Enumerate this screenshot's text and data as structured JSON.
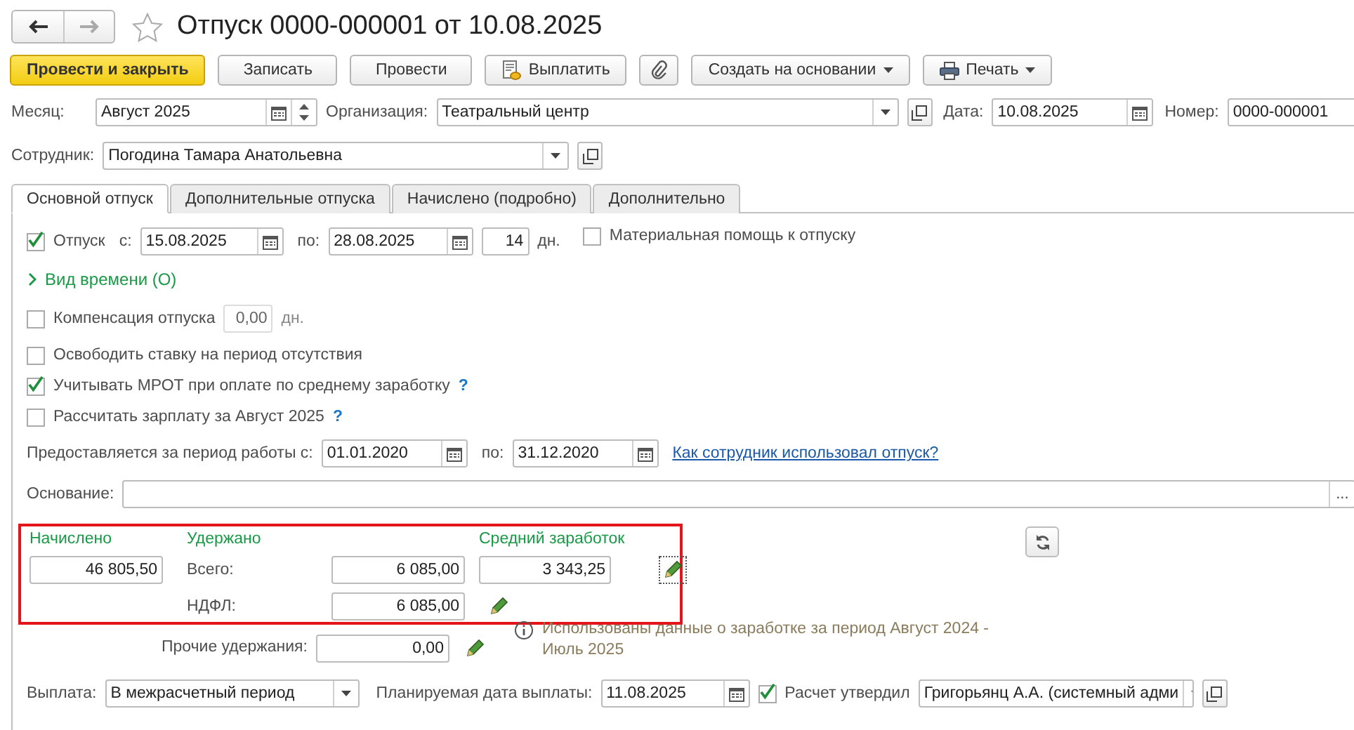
{
  "title": "Отпуск 0000-000001 от 10.08.2025",
  "toolbar": [
    {
      "label": "Провести и закрыть",
      "kind": "primary"
    },
    {
      "label": "Записать",
      "kind": "plain"
    },
    {
      "label": "Провести",
      "kind": "plain"
    },
    {
      "label": "Выплатить",
      "kind": "pay"
    },
    {
      "kind": "attach"
    },
    {
      "label": "Создать на основании",
      "kind": "menu"
    },
    {
      "label": "Печать",
      "kind": "print"
    }
  ],
  "month": {
    "label": "Месяц:",
    "value": "Август 2025"
  },
  "organization": {
    "label": "Организация:",
    "value": "Театральный центр"
  },
  "date": {
    "label": "Дата:",
    "value": "10.08.2025"
  },
  "number": {
    "label": "Номер:",
    "value": "0000-000001"
  },
  "employee": {
    "label": "Сотрудник:",
    "value": "Погодина Тамара Анатольевна"
  },
  "tabs": [
    {
      "label": "Основной отпуск",
      "selected": true
    },
    {
      "label": "Дополнительные отпуска",
      "selected": false
    },
    {
      "label": "Начислено (подробно)",
      "selected": false
    },
    {
      "label": "Дополнительно",
      "selected": false
    }
  ],
  "vacation": {
    "checked": true,
    "label": "Отпуск",
    "from_label": "с:",
    "from": "15.08.2025",
    "to_label": "по:",
    "to": "28.08.2025",
    "days": "14",
    "unit": "дн."
  },
  "material_aid": {
    "checked": false,
    "label": "Материальная помощь к отпуску"
  },
  "time_kind": {
    "label": "Вид времени (О)",
    "expanded": false
  },
  "compensation": {
    "checked": false,
    "label": "Компенсация отпуска",
    "value": "0,00",
    "unit": "дн."
  },
  "options": [
    {
      "checked": false,
      "label": "Освободить ставку на период отсутствия"
    },
    {
      "checked": true,
      "label": "Учитывать МРОТ при оплате по среднему заработку",
      "help": "?"
    },
    {
      "checked": false,
      "label": "Рассчитать зарплату за Август 2025",
      "help": "?"
    }
  ],
  "period": {
    "label": "Предоставляется за период работы с:",
    "from": "01.01.2020",
    "to_label": "по:",
    "to": "31.12.2020",
    "link": "Как сотрудник использовал отпуск?"
  },
  "basis": {
    "label": "Основание:",
    "button": "..."
  },
  "totals": {
    "accrued_title": "Начислено",
    "accrued": "46 805,50",
    "withheld_title": "Удержано",
    "total_label": "Всего:",
    "total": "6 085,00",
    "ndfl_label": "НДФЛ:",
    "ndfl": "6 085,00",
    "avg_title": "Средний заработок",
    "avg": "3 343,25",
    "other_label": "Прочие удержания:",
    "other": "0,00",
    "info": "Использованы данные о заработке за период Август 2024 - Июль 2025"
  },
  "payment": {
    "label": "Выплата:",
    "value": "В межрасчетный период",
    "planned_label": "Планируемая дата выплаты:",
    "planned": "11.08.2025",
    "approved": true,
    "approved_label": "Расчет утвердил",
    "approver": "Григорьянц А.А. (системный адми"
  }
}
